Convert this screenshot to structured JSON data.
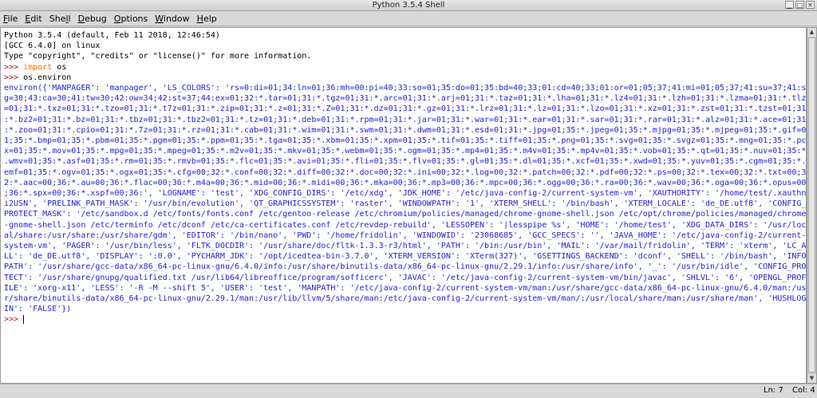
{
  "window": {
    "title": "Python 3.5.4 Shell"
  },
  "menus": [
    {
      "u": "F",
      "rest": "ile"
    },
    {
      "u": "E",
      "rest": "dit"
    },
    {
      "u": "",
      "rest": "She",
      "u2": "l",
      "rest2": "l"
    },
    {
      "u": "D",
      "rest": "ebug"
    },
    {
      "u": "O",
      "rest": "ptions"
    },
    {
      "u": "W",
      "rest": "indow"
    },
    {
      "u": "H",
      "rest": "elp"
    }
  ],
  "shell": {
    "banner": [
      "Python 3.5.4 (default, Feb 11 2018, 12:46:54)",
      "[GCC 6.4.0] on linux",
      "Type \"copyright\", \"credits\" or \"license()\" for more information."
    ],
    "prompt": ">>> ",
    "cmd1_kw": "import",
    "cmd1_rest": " os",
    "cmd2": "os.environ",
    "output": [
      "environ({'MANPAGER': 'manpager', 'LS_COLORS': 'rs=0:di=01;34:ln=01;36:mh=00:pi=40;33:so=01;35:do=01;35:bd=40;33;01:cd=40;33;01:or=01;05;37;41:mi=01;05;37;41:su=37;41:s",
      "g=30;43:ca=30;41:tw=30;42:ow=34;42:st=37;44:ex=01;32:*.tar=01;31:*.tgz=01;31:*.arc=01;31:*.arj=01;31:*.taz=01;31:*.lha=01;31:*.lz4=01;31:*.lzh=01;31:*.lzma=01;31:*.tlz",
      "=01;31:*.txz=01;31:*.tzo=01;31:*.t7z=01;31:*.zip=01;31:*.z=01;31:*.Z=01;31:*.dz=01;31:*.gz=01;31:*.lrz=01;31:*.lz=01;31:*.lzo=01;31:*.xz=01;31:*.zst=01;31:*.tzst=01;31",
      ":*.bz2=01;31:*.bz=01;31:*.tbz=01;31:*.tbz2=01;31:*.tz=01;31:*.deb=01;31:*.rpm=01;31:*.jar=01;31:*.war=01;31:*.ear=01;31:*.sar=01;31:*.rar=01;31:*.alz=01;31:*.ace=01;31",
      ":*.zoo=01;31:*.cpio=01;31:*.7z=01;31:*.rz=01;31:*.cab=01;31:*.wim=01;31:*.swm=01;31:*.dwm=01;31:*.esd=01;31:*.jpg=01;35:*.jpeg=01;35:*.mjpg=01;35:*.mjpeg=01;35:*.gif=0",
      "1;35:*.bmp=01;35:*.pbm=01;35:*.pgm=01;35:*.ppm=01;35:*.tga=01;35:*.xbm=01;35:*.xpm=01;35:*.tif=01;35:*.tiff=01;35:*.png=01;35:*.svg=01;35:*.svgz=01;35:*.mng=01;35:*.pc",
      "x=01;35:*.mov=01;35:*.mpg=01;35:*.mpeg=01;35:*.m2v=01;35:*.mkv=01;35:*.webm=01;35:*.ogm=01;35:*.mp4=01;35:*.m4v=01;35:*.mp4v=01;35:*.vob=01;35:*.qt=01;35:*.nuv=01;35:*",
      ".wmv=01;35:*.asf=01;35:*.rm=01;35:*.rmvb=01;35:*.flc=01;35:*.avi=01;35:*.fli=01;35:*.flv=01;35:*.gl=01;35:*.dl=01;35:*.xcf=01;35:*.xwd=01;35:*.yuv=01;35:*.cgm=01;35:*.",
      "emf=01;35:*.ogv=01;35:*.ogx=01;35:*.cfg=00;32:*.conf=00;32:*.diff=00;32:*.doc=00;32:*.ini=00;32:*.log=00;32:*.patch=00;32:*.pdf=00;32:*.ps=00;32:*.tex=00;32:*.txt=00;3",
      "2:*.aac=00;36:*.au=00;36:*.flac=00;36:*.m4a=00;36:*.mid=00;36:*.midi=00;36:*.mka=00;36:*.mp3=00;36:*.mpc=00;36:*.ogg=00;36:*.ra=00;36:*.wav=00;36:*.oga=00;36:*.opus=00",
      ";36:*.spx=00;36:*.xspf=00;36:', 'LOGNAME': 'test', 'XDG_CONFIG_DIRS': '/etc/xdg', 'JDK_HOME': '/etc/java-config-2/current-system-vm', 'XAUTHORITY': '/home/test/.xauthn",
      "i2USN', 'PRELINK_PATH_MASK': '/usr/bin/evolution', 'QT_GRAPHICSSYSTEM': 'raster', 'WINDOWPATH': '1', 'XTERM_SHELL': '/bin/bash', 'XTERM_LOCALE': 'de_DE.utf8', 'CONFIG_",
      "PROTECT_MASK': '/etc/sandbox.d /etc/fonts/fonts.conf /etc/gentoo-release /etc/chromium/policies/managed/chrome-gnome-shell.json /etc/opt/chrome/policies/managed/chrome",
      "-gnome-shell.json /etc/terminfo /etc/dconf /etc/ca-certificates.conf /etc/revdep-rebuild', 'LESSOPEN': '|lesspipe %s', 'HOME': '/home/test', 'XDG_DATA_DIRS': '/usr/loc",
      "al/share:/usr/share:/usr/share/gdm', 'EDITOR': '/bin/nano', 'PWD': '/home/fridolin', 'WINDOWID': '23068685', 'GCC_SPECS': '', 'JAVA_HOME': '/etc/java-config-2/current-",
      "system-vm', 'PAGER': '/usr/bin/less', 'FLTK_DOCDIR': '/usr/share/doc/fltk-1.3.3-r3/html', 'PATH': '/bin:/usr/bin', 'MAIL': '/var/mail/fridolin', 'TERM': 'xterm', 'LC_A",
      "LL': 'de_DE.utf8', 'DISPLAY': ':0.0', 'PYCHARM_JDK': '/opt/icedtea-bin-3.7.0', 'XTERM_VERSION': 'XTerm(327)', 'GSETTINGS_BACKEND': 'dconf', 'SHELL': '/bin/bash', 'INFO",
      "PATH': '/usr/share/gcc-data/x86_64-pc-linux-gnu/6.4.0/info:/usr/share/binutils-data/x86_64-pc-linux-gnu/2.29.1/info:/usr/share/info', '_': '/usr/bin/idle', 'CONFIG_PRO",
      "TECT': '/usr/share/gnupg/qualified.txt /usr/lib64/libreoffice/program/sofficerc', 'JAVAC': '/etc/java-config-2/current-system-vm/bin/javac', 'SHLVL': '6', 'OPENGL_PROF",
      "ILE': 'xorg-x11', 'LESS': '-R -M --shift 5', 'USER': 'test', 'MANPATH': '/etc/java-config-2/current-system-vm/man:/usr/share/gcc-data/x86_64-pc-linux-gnu/6.4.0/man:/us",
      "r/share/binutils-data/x86_64-pc-linux-gnu/2.29.1/man:/usr/lib/llvm/5/share/man:/etc/java-config-2/current-system-vm/man/:/usr/local/share/man:/usr/share/man', 'HUSHLOG",
      "IN': 'FALSE'})"
    ]
  },
  "status": {
    "line": "Ln: 7",
    "col": "Col: 4"
  }
}
